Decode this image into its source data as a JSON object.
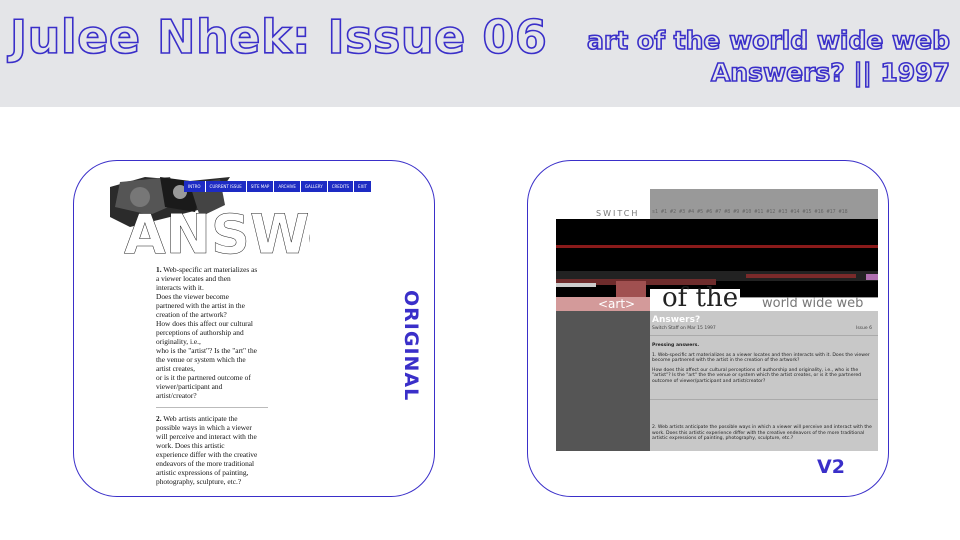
{
  "header": {
    "title": "Julee Nhek: Issue 06",
    "subtitle": "art of the world wide web",
    "subtitle2": "Answers? || 1997"
  },
  "labels": {
    "original": "ORIGINAL",
    "v2": "V2"
  },
  "original": {
    "banner_logo_text": "ANSWers?",
    "nav": [
      "INTRO",
      "CURRENT ISSUE",
      "SITE MAP",
      "ARCHIVE",
      "GALLERY",
      "CREDITS",
      "EXIT"
    ],
    "q1_number": "1.",
    "q1_lines": [
      "Web-specific art materializes as",
      "a viewer locates and then",
      "interacts with it."
    ],
    "q1b_lines": [
      "Does the viewer become",
      "partnered with the artist in the",
      "creation of the artwork?"
    ],
    "q1c_lines": [
      "How does this affect our cultural",
      "perceptions of authorship and",
      "originality, i.e.,"
    ],
    "q1d_lines": [
      "who is the \"artist\"? Is the \"art\" the",
      "the venue or system which the",
      "artist creates,"
    ],
    "q1e_lines": [
      "or is it the partnered outcome of",
      "viewer/participant and",
      "artist/creator?"
    ],
    "q2_number": "2.",
    "q2_lines": [
      "Web artists anticipate the",
      "possible ways in which a viewer",
      "will perceive and interact with the",
      "work. Does this artistic",
      "experience differ with the creative",
      "endeavors of the more traditional",
      "artistic expressions of painting,",
      "photography, sculpture, etc.?"
    ]
  },
  "v2": {
    "switch": "SWITCH",
    "numbers": "s1 #1 #2 #3 #4 #5 #6 #7 #8 #9 #10 #11 #12 #13 #14 #15 #16 #17 #18",
    "art": "<art>",
    "ofthe": "of the",
    "www": "world wide web",
    "heading": "Answers?",
    "byline": "Switch Staff on Mar 15 1997",
    "issue": "Issue 6",
    "pressing": "Pressing answers.",
    "p1": "1. Web-specific art materializes as a viewer locates and then interacts with it. Does the viewer become partnered with the artist in the creation of the artwork?",
    "p2": "How does this affect our cultural perceptions of authorship and originality, i.e., who is the \"artist\"? Is the \"art\" the the venue or system which the artist creates, or is it the partnered outcome of viewer/participant and artist/creator?",
    "p3": "2. Web artists anticipate the possible ways in which a viewer will perceive and interact with the work. Does this artistic experience differ with the creative endeavors of the more traditional artistic expressions of painting, photography, sculpture, etc.?"
  },
  "colors": {
    "accent": "#3a2fc9",
    "header_bg": "#e4e5e8",
    "nav_blue": "#1d2bc4"
  }
}
